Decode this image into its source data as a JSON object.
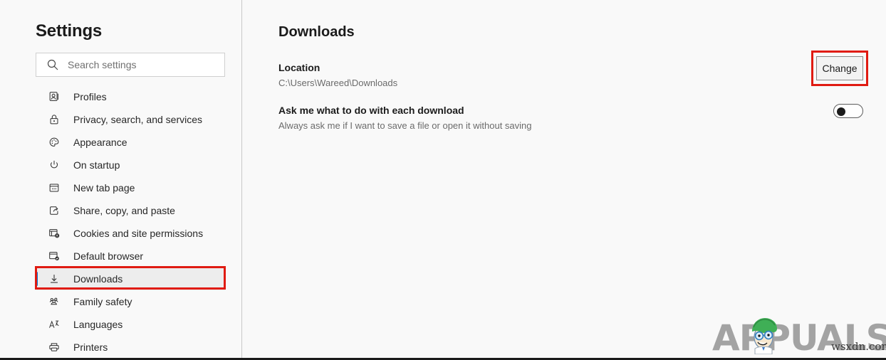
{
  "sidebar": {
    "title": "Settings",
    "search": {
      "placeholder": "Search settings",
      "value": "",
      "icon": "search-icon"
    },
    "items": [
      {
        "label": "Profiles",
        "icon": "profiles-icon",
        "selected": false
      },
      {
        "label": "Privacy, search, and services",
        "icon": "lock-icon",
        "selected": false
      },
      {
        "label": "Appearance",
        "icon": "palette-icon",
        "selected": false
      },
      {
        "label": "On startup",
        "icon": "power-icon",
        "selected": false
      },
      {
        "label": "New tab page",
        "icon": "new-tab-icon",
        "selected": false
      },
      {
        "label": "Share, copy, and paste",
        "icon": "share-icon",
        "selected": false
      },
      {
        "label": "Cookies and site permissions",
        "icon": "cookies-icon",
        "selected": false
      },
      {
        "label": "Default browser",
        "icon": "default-browser-icon",
        "selected": false
      },
      {
        "label": "Downloads",
        "icon": "download-icon",
        "selected": true
      },
      {
        "label": "Family safety",
        "icon": "family-icon",
        "selected": false
      },
      {
        "label": "Languages",
        "icon": "languages-icon",
        "selected": false
      },
      {
        "label": "Printers",
        "icon": "printer-icon",
        "selected": false
      }
    ]
  },
  "content": {
    "page_title": "Downloads",
    "settings": [
      {
        "label": "Location",
        "sub": "C:\\Users\\Wareed\\Downloads",
        "action_label": "Change"
      },
      {
        "label": "Ask me what to do with each download",
        "sub": "Always ask me if I want to save a file or open it without saving",
        "toggle_state": "off"
      }
    ]
  },
  "annotations": {
    "color": "#e01b12",
    "targets": [
      "sidebar-item-downloads",
      "change-button"
    ]
  },
  "watermark": {
    "brand": "APPUALS",
    "brand_prefix": "A",
    "brand_suffix": "PUALS",
    "site": "wsxdn.com",
    "color": "#a3a3a3"
  }
}
